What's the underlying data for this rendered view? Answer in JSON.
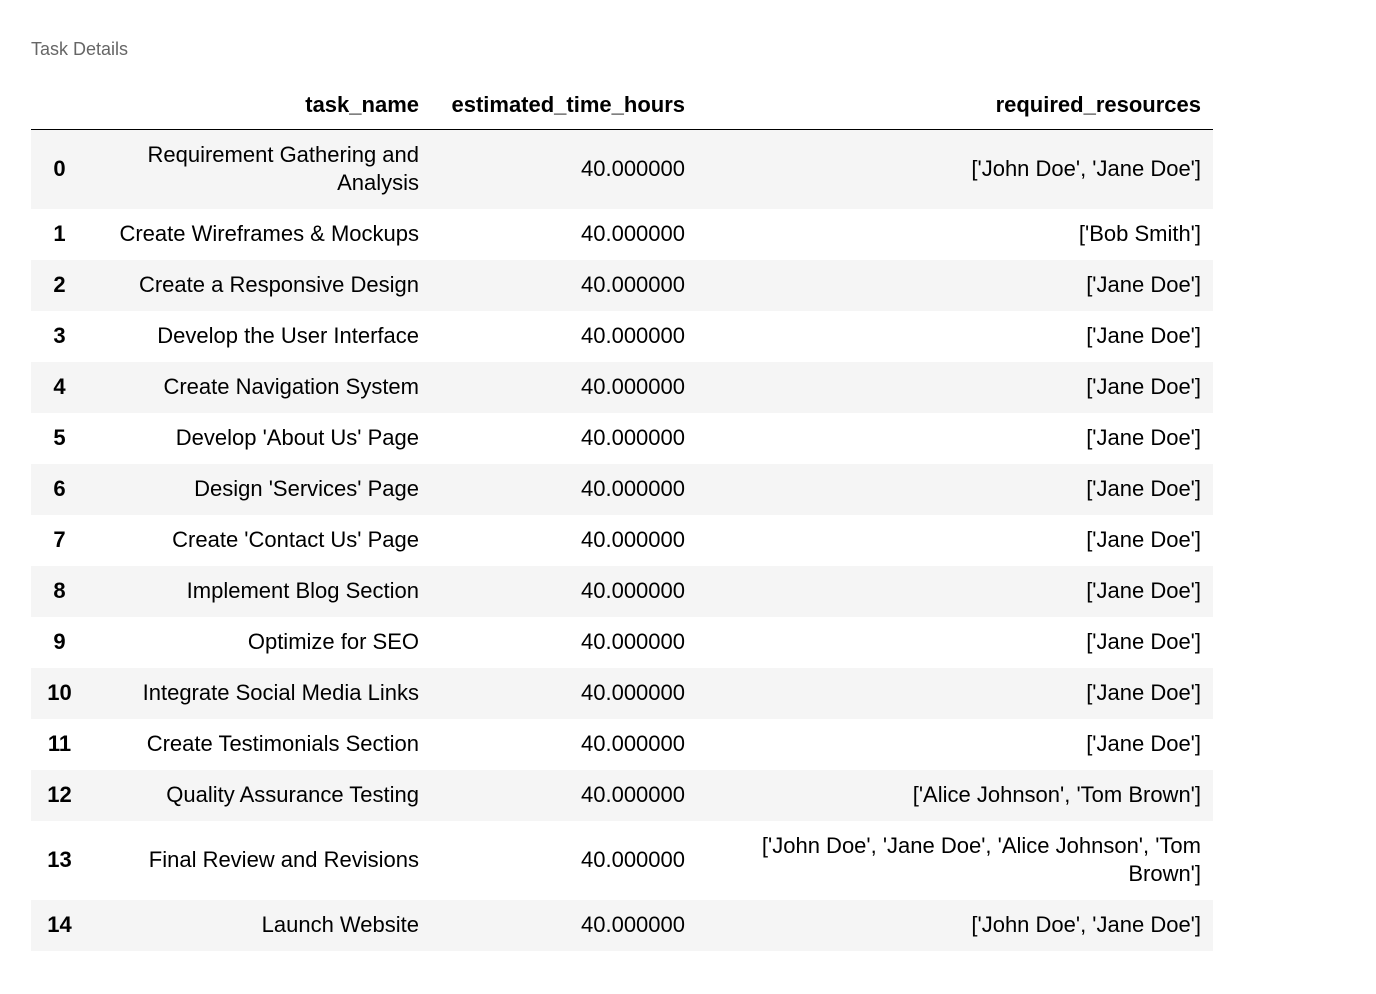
{
  "caption": "Task Details",
  "columns": [
    "",
    "task_name",
    "estimated_time_hours",
    "required_resources"
  ],
  "rows": [
    {
      "index": "0",
      "task_name": "Requirement Gathering and Analysis",
      "estimated_time_hours": "40.000000",
      "required_resources": "['John Doe', 'Jane Doe']"
    },
    {
      "index": "1",
      "task_name": "Create Wireframes & Mockups",
      "estimated_time_hours": "40.000000",
      "required_resources": "['Bob Smith']"
    },
    {
      "index": "2",
      "task_name": "Create a Responsive Design",
      "estimated_time_hours": "40.000000",
      "required_resources": "['Jane Doe']"
    },
    {
      "index": "3",
      "task_name": "Develop the User Interface",
      "estimated_time_hours": "40.000000",
      "required_resources": "['Jane Doe']"
    },
    {
      "index": "4",
      "task_name": "Create Navigation System",
      "estimated_time_hours": "40.000000",
      "required_resources": "['Jane Doe']"
    },
    {
      "index": "5",
      "task_name": "Develop 'About Us' Page",
      "estimated_time_hours": "40.000000",
      "required_resources": "['Jane Doe']"
    },
    {
      "index": "6",
      "task_name": "Design 'Services' Page",
      "estimated_time_hours": "40.000000",
      "required_resources": "['Jane Doe']"
    },
    {
      "index": "7",
      "task_name": "Create 'Contact Us' Page",
      "estimated_time_hours": "40.000000",
      "required_resources": "['Jane Doe']"
    },
    {
      "index": "8",
      "task_name": "Implement Blog Section",
      "estimated_time_hours": "40.000000",
      "required_resources": "['Jane Doe']"
    },
    {
      "index": "9",
      "task_name": "Optimize for SEO",
      "estimated_time_hours": "40.000000",
      "required_resources": "['Jane Doe']"
    },
    {
      "index": "10",
      "task_name": "Integrate Social Media Links",
      "estimated_time_hours": "40.000000",
      "required_resources": "['Jane Doe']"
    },
    {
      "index": "11",
      "task_name": "Create Testimonials Section",
      "estimated_time_hours": "40.000000",
      "required_resources": "['Jane Doe']"
    },
    {
      "index": "12",
      "task_name": "Quality Assurance Testing",
      "estimated_time_hours": "40.000000",
      "required_resources": "['Alice Johnson', 'Tom Brown']"
    },
    {
      "index": "13",
      "task_name": "Final Review and Revisions",
      "estimated_time_hours": "40.000000",
      "required_resources": "['John Doe', 'Jane Doe', 'Alice Johnson', 'Tom Brown']"
    },
    {
      "index": "14",
      "task_name": "Launch Website",
      "estimated_time_hours": "40.000000",
      "required_resources": "['John Doe', 'Jane Doe']"
    }
  ]
}
